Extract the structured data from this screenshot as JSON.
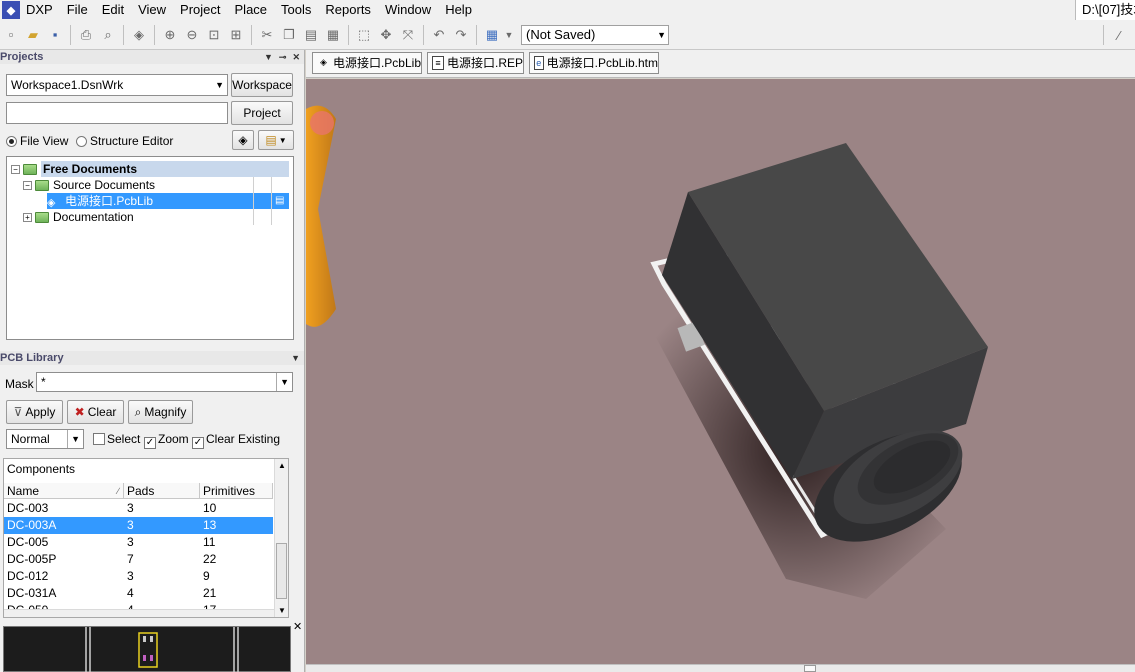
{
  "menu": {
    "logo": "DXP",
    "items": [
      "DXP",
      "File",
      "Edit",
      "View",
      "Project",
      "Place",
      "Tools",
      "Reports",
      "Window",
      "Help"
    ],
    "path_text": "D:\\[07]技术"
  },
  "toolbar": {
    "save_state": "(Not Saved)"
  },
  "projects_panel": {
    "title": "Projects",
    "workspace_value": "Workspace1.DsnWrk",
    "workspace_button": "Workspace",
    "project_button": "Project",
    "view_file": "File View",
    "view_structure": "Structure Editor",
    "tree": {
      "root": "Free Documents",
      "source": "Source Documents",
      "file": "电源接口.PcbLib",
      "documentation": "Documentation"
    }
  },
  "pcb_library": {
    "title": "PCB Library",
    "mask_label": "Mask",
    "mask_value": "*",
    "apply": "Apply",
    "clear": "Clear",
    "magnify": "Magnify",
    "mode": "Normal",
    "select": "Select",
    "zoom": "Zoom",
    "clear_existing": "Clear Existing",
    "components_title": "Components",
    "columns": [
      "Name",
      "Pads",
      "Primitives"
    ],
    "rows": [
      {
        "name": "DC-003",
        "pads": "3",
        "primitives": "10"
      },
      {
        "name": "DC-003A",
        "pads": "3",
        "primitives": "13"
      },
      {
        "name": "DC-005",
        "pads": "3",
        "primitives": "11"
      },
      {
        "name": "DC-005P",
        "pads": "7",
        "primitives": "22"
      },
      {
        "name": "DC-012",
        "pads": "3",
        "primitives": "9"
      },
      {
        "name": "DC-031A",
        "pads": "4",
        "primitives": "21"
      },
      {
        "name": "DC-050",
        "pads": "4",
        "primitives": "17"
      }
    ],
    "selected_index": 1
  },
  "document_tabs": [
    "电源接口.PcbLib",
    "电源接口.REP",
    "电源接口.PcbLib.htm"
  ],
  "colors": {
    "viewport_bg": "#9b8485",
    "selection": "#3399ff",
    "component_body": "#3c3c3e"
  }
}
